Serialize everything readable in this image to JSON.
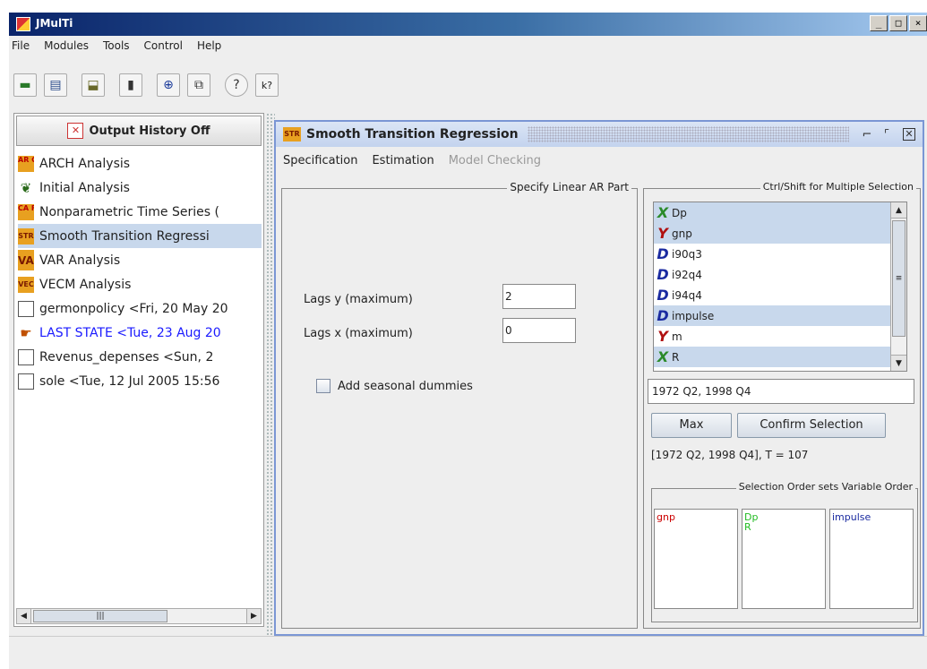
{
  "window": {
    "title": "JMulTi",
    "controls": [
      "_",
      "□",
      "×"
    ]
  },
  "menubar": [
    "File",
    "Modules",
    "Tools",
    "Control",
    "Help"
  ],
  "toolbar": {
    "icons": [
      "open-folder-icon",
      "save-icon",
      "import-icon",
      "calculator-icon",
      "navigator-icon",
      "copy-icon",
      "help-icon",
      "context-help-icon"
    ],
    "glyphs": [
      "▬",
      "▤",
      "⬓",
      "▮",
      "⊕",
      "⧉",
      "?",
      "k?"
    ]
  },
  "sidebar": {
    "history_button": "Output History Off",
    "items": [
      {
        "label": "ARCH Analysis",
        "icon": "arch-icon",
        "icon_text": "AR CH"
      },
      {
        "label": "Initial Analysis",
        "icon": "leaf-icon",
        "icon_text": "❦"
      },
      {
        "label": "Nonparametric Time Series (",
        "icon": "ca-fpe-icon",
        "icon_text": "CA FPE"
      },
      {
        "label": "Smooth Transition Regressi",
        "icon": "str-icon",
        "icon_text": "STR",
        "selected": true
      },
      {
        "label": "VAR Analysis",
        "icon": "var-icon",
        "icon_text": "VAR"
      },
      {
        "label": "VECM Analysis",
        "icon": "vec-icon",
        "icon_text": "VEC"
      },
      {
        "label": "germonpolicy <Fri, 20 May 20",
        "icon": "document-icon",
        "icon_text": ""
      },
      {
        "label": "LAST STATE <Tue, 23 Aug 20",
        "icon": "state-icon",
        "icon_text": "☛",
        "highlight": true
      },
      {
        "label": "Revenus_depenses <Sun, 2",
        "icon": "document-icon",
        "icon_text": ""
      },
      {
        "label": "sole <Tue, 12 Jul 2005 15:56",
        "icon": "document-icon",
        "icon_text": ""
      }
    ]
  },
  "inner": {
    "icon_text": "STR",
    "title": "Smooth Transition Regression",
    "menu": {
      "specification": "Specification",
      "estimation": "Estimation",
      "model_checking": "Model Checking"
    },
    "linear_ar": {
      "legend": "Specify Linear AR Part",
      "lags_y_label": "Lags y (maximum)",
      "lags_y_value": "2",
      "lags_x_label": "Lags x (maximum)",
      "lags_x_value": "0",
      "seasonal_label": "Add seasonal dummies"
    },
    "selection": {
      "legend": "Ctrl/Shift for Multiple Selection",
      "variables": [
        {
          "type": "X",
          "name": "Dp",
          "selected": true
        },
        {
          "type": "Y",
          "name": "gnp",
          "selected": true
        },
        {
          "type": "D",
          "name": "i90q3",
          "selected": false
        },
        {
          "type": "D",
          "name": "i92q4",
          "selected": false
        },
        {
          "type": "D",
          "name": "i94q4",
          "selected": false
        },
        {
          "type": "D",
          "name": "impulse",
          "selected": true
        },
        {
          "type": "Y",
          "name": "m",
          "selected": false
        },
        {
          "type": "X",
          "name": "R",
          "selected": true
        }
      ],
      "range": "1972 Q2, 1998 Q4",
      "max_button": "Max",
      "confirm_button": "Confirm Selection",
      "status": "[1972 Q2, 1998 Q4],  T = 107",
      "order_legend": "Selection Order sets Variable Order",
      "order_boxes": [
        {
          "items": [
            "gnp"
          ],
          "color": "#cc0000"
        },
        {
          "items": [
            "Dp",
            "R"
          ],
          "color": "#22bb22"
        },
        {
          "items": [
            "impulse"
          ],
          "color": "#1a2aa0"
        }
      ]
    }
  },
  "colors": {
    "titlebar": "#0a246a",
    "selection": "#c8d8ec",
    "link": "#1a1aff"
  }
}
